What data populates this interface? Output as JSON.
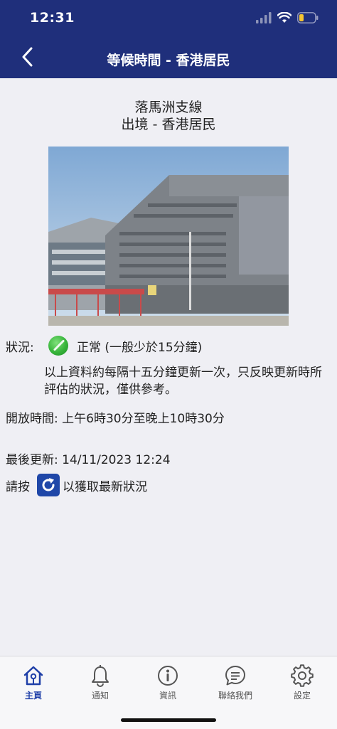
{
  "status_bar": {
    "time": "12:31"
  },
  "header": {
    "title": "等候時間 - 香港居民"
  },
  "main": {
    "subtitle_line1": "落馬洲支線",
    "subtitle_line2": "出境 - 香港居民",
    "status_label": "狀況:",
    "status_text": "正常 (一般少於15分鐘)",
    "status_color": "#37b43a",
    "note": "以上資料約每隔十五分鐘更新一次，只反映更新時所評估的狀況，僅供參考。",
    "open_hours": "開放時間: 上午6時30分至晚上10時30分",
    "last_update": "最後更新: 14/11/2023 12:24",
    "refresh_prefix": "請按",
    "refresh_suffix": "以獲取最新狀況"
  },
  "tabs": [
    {
      "label": "主頁",
      "icon": "home-icon",
      "active": true
    },
    {
      "label": "通知",
      "icon": "bell-icon",
      "active": false
    },
    {
      "label": "資訊",
      "icon": "info-icon",
      "active": false
    },
    {
      "label": "聯絡我們",
      "icon": "chat-icon",
      "active": false
    },
    {
      "label": "設定",
      "icon": "gear-icon",
      "active": false
    }
  ],
  "colors": {
    "header_bg": "#1f2f7b",
    "accent": "#1f3fa8"
  }
}
